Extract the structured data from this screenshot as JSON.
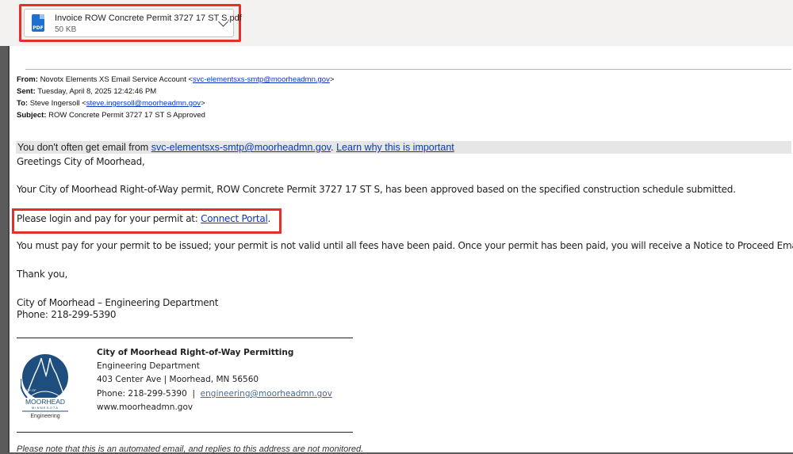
{
  "attachment": {
    "file_name": "Invoice ROW Concrete Permit 3727 17 ST S.pdf",
    "file_size": "50 KB",
    "icon": "pdf-file-icon",
    "icon_label": "PDF",
    "icon_color": "#1e6fd0"
  },
  "header": {
    "from_label": "From:",
    "from_name": "Novotx Elements XS Email Service Account <",
    "from_email": "svc-elementsxs-smtp@moorheadmn.gov",
    "from_close": ">",
    "sent_label": "Sent:",
    "sent_value": "Tuesday, April 8, 2025 12:42:46 PM",
    "to_label": "To:",
    "to_name": "Steve Ingersoll <",
    "to_email": "steve.ingersoll@moorheadmn.gov",
    "to_close": ">",
    "subject_label": "Subject:",
    "subject_value": "ROW Concrete Permit 3727 17 ST S Approved"
  },
  "notice": {
    "prefix": "You don't often get email from ",
    "email": "svc-elementsxs-smtp@moorheadmn.gov",
    "mid": ". ",
    "link": "Learn why this is important"
  },
  "body": {
    "greeting": "Greetings City of Moorhead,",
    "para1": "Your City of Moorhead Right-of-Way permit, ROW Concrete Permit 3727 17 ST S, has been approved based on the specified construction schedule submitted.",
    "login_prefix": "Please login and pay for your permit at: ",
    "login_link": "Connect Portal",
    "login_suffix": ".",
    "para3": "You must pay for your permit to be issued; your permit is not valid until all fees have been paid. Once your permit has been paid, you will receive a Notice to Proceed Email.",
    "thanks": "Thank you,",
    "dept": "City of Moorhead – Engineering Department",
    "phone": "Phone: 218-299-5390"
  },
  "signature": {
    "title": "City of Moorhead Right-of-Way Permitting",
    "dept": "Engineering Department",
    "address": "403 Center Ave | Moorhead, MN 56560",
    "phone": "Phone: 218-299-5390  |  ",
    "email": "engineering@moorheadmn.gov",
    "website": "www.moorheadmn.gov",
    "logo_city_of": "CITY OF",
    "logo_name": "MOORHEAD",
    "logo_state": "MINNESOTA",
    "logo_sub": "Engineering",
    "logo_color": "#1d4e7e"
  },
  "footer": {
    "note": "Please note that this is an automated email, and replies to this address are not monitored."
  },
  "colors": {
    "highlight": "#e4302b",
    "link": "#0b35c9"
  }
}
